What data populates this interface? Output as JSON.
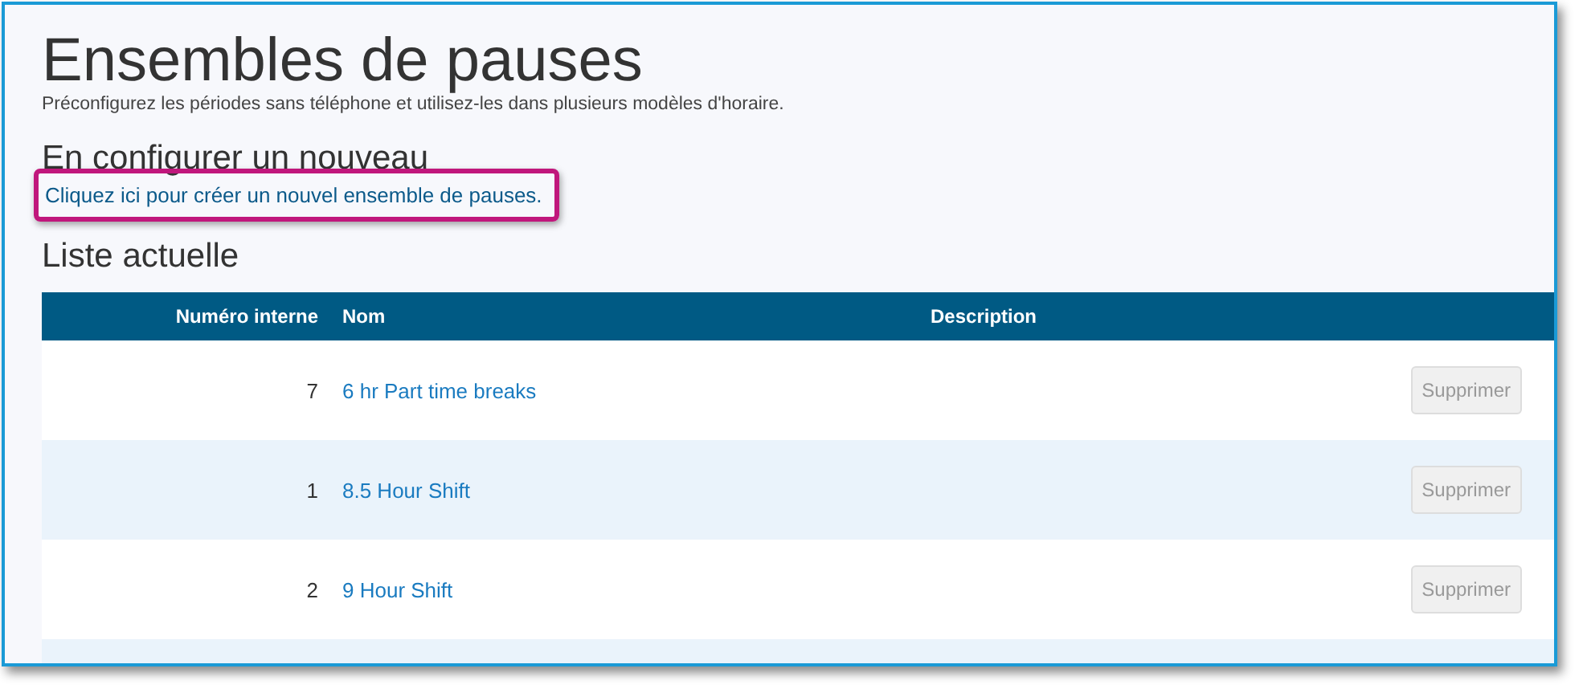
{
  "title": "Ensembles de pauses",
  "subtitle": "Préconfigurez les périodes sans téléphone et utilisez-les dans plusieurs modèles d'horaire.",
  "new_section": {
    "heading": "En configurer un nouveau",
    "link": "Cliquez ici pour créer un nouvel ensemble de pauses.",
    "highlighted": true
  },
  "list_heading": "Liste actuelle",
  "table": {
    "columns": [
      "Numéro interne",
      "Nom",
      "Description"
    ],
    "rows": [
      {
        "id": "7",
        "name": "6 hr Part time breaks",
        "action": "Supprimer",
        "disabled": true
      },
      {
        "id": "1",
        "name": "8.5 Hour Shift",
        "action": "Supprimer",
        "disabled": true
      },
      {
        "id": "2",
        "name": "9 Hour Shift",
        "action": "Supprimer",
        "disabled": true
      }
    ]
  }
}
